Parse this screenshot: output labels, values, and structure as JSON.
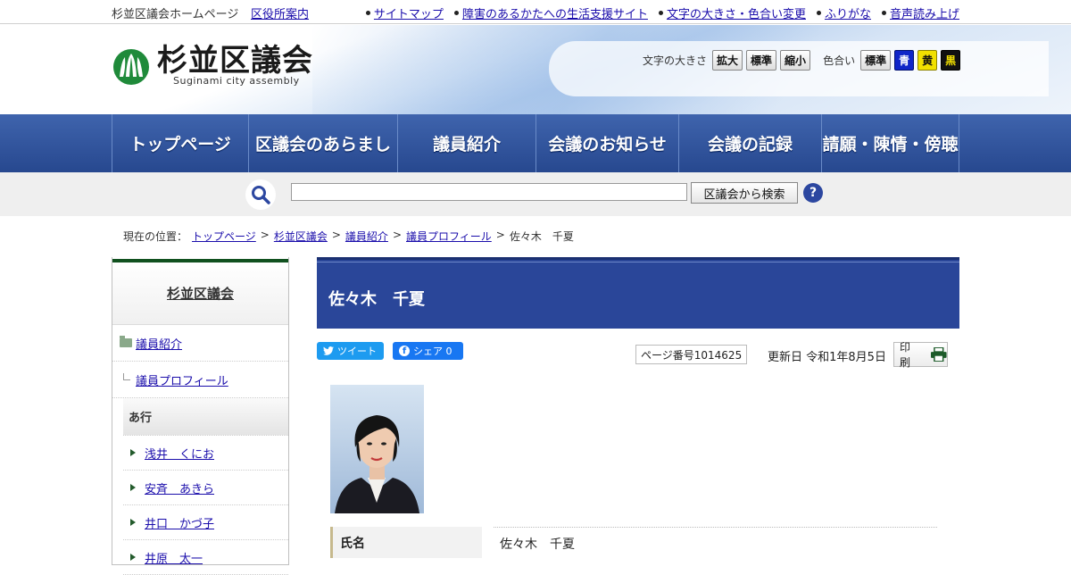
{
  "topbar": {
    "site_name": "杉並区議会ホームページ",
    "guide": "区役所案内",
    "links": [
      "サイトマップ",
      "障害のあるかたへの生活支援サイト",
      "文字の大きさ・色合い変更",
      "ふりがな",
      "音声読み上げ"
    ]
  },
  "header": {
    "logo_title": "杉並区議会",
    "logo_sub": "Suginami city assembly",
    "font_size_label": "文字の大きさ",
    "font_buttons": [
      "拡大",
      "標準",
      "縮小"
    ],
    "color_label": "色合い",
    "color_buttons": [
      "標準",
      "青",
      "黄",
      "黒"
    ],
    "colors": {
      "blue": "#1026c8",
      "yellow": "#f1e000",
      "black": "#111111"
    }
  },
  "nav": [
    "トップページ",
    "区議会のあらまし",
    "議員紹介",
    "会議のお知らせ",
    "会議の記録",
    "請願・陳情・傍聴"
  ],
  "search": {
    "placeholder": "",
    "button": "区議会から検索",
    "help": "?"
  },
  "breadcrumb": {
    "label": "現在の位置：",
    "items": [
      "トップページ",
      "杉並区議会",
      "議員紹介",
      "議員プロフィール"
    ],
    "current": "佐々木　千夏",
    "separator": ">"
  },
  "sidebar": {
    "title": "杉並区議会",
    "item1": "議員紹介",
    "item2": "議員プロフィール",
    "group": "あ行",
    "members": [
      "浅井　くにお",
      "安斉　あきら",
      "井口　かづ子",
      "井原　太一"
    ]
  },
  "main": {
    "title": "佐々木　千夏",
    "tweet": "ツイート",
    "share": "シェア 0",
    "page_no": "ページ番号1014625",
    "updated": "更新日 令和1年8月5日",
    "print": "印刷",
    "table": {
      "label": "氏名",
      "value": "佐々木　千夏"
    }
  },
  "accent_colors": {
    "nav": "#2f53a0",
    "title_bar": "#2a4699",
    "sidebar_top": "#11511f"
  }
}
